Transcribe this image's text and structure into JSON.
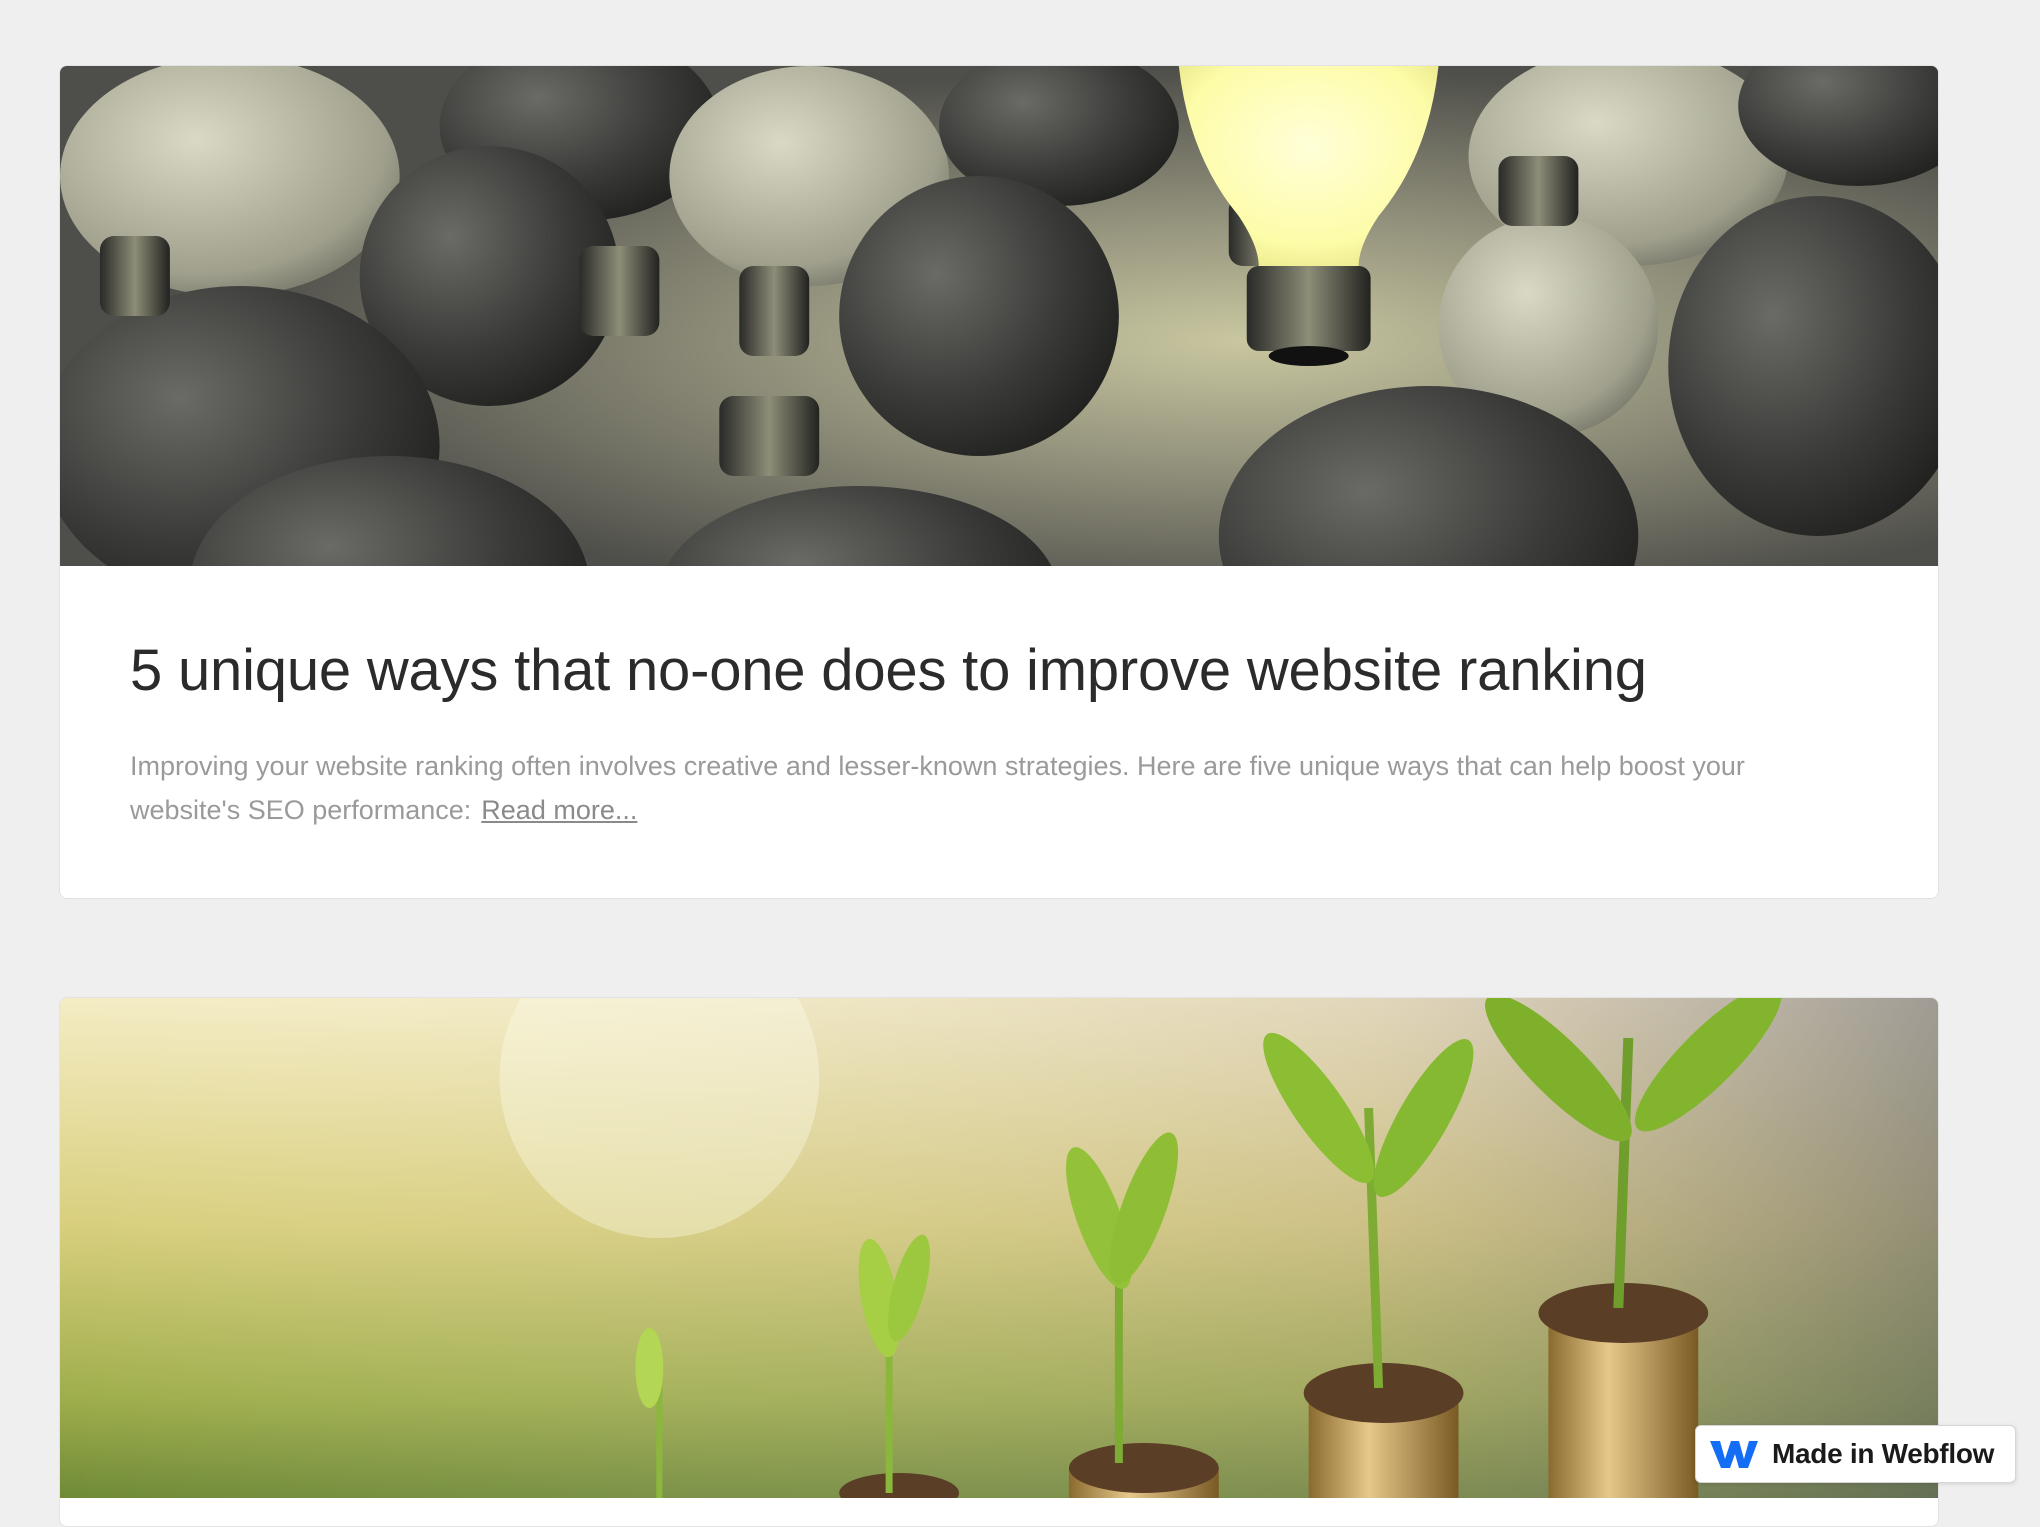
{
  "posts": [
    {
      "image_alt": "light-bulbs-image",
      "title": "5 unique ways that no-one does to improve website ranking",
      "excerpt": "Improving your website ranking often involves creative and lesser-known strategies. Here are five unique ways that can help boost your website's SEO performance:",
      "read_more": "Read more..."
    },
    {
      "image_alt": "plants-on-coins-image"
    }
  ],
  "badge": {
    "label": "Made in Webflow"
  },
  "colors": {
    "page_bg": "#efefef",
    "card_bg": "#ffffff",
    "title": "#2b2b2b",
    "excerpt": "#9a9a9a",
    "webflow_blue": "#146ef5"
  }
}
